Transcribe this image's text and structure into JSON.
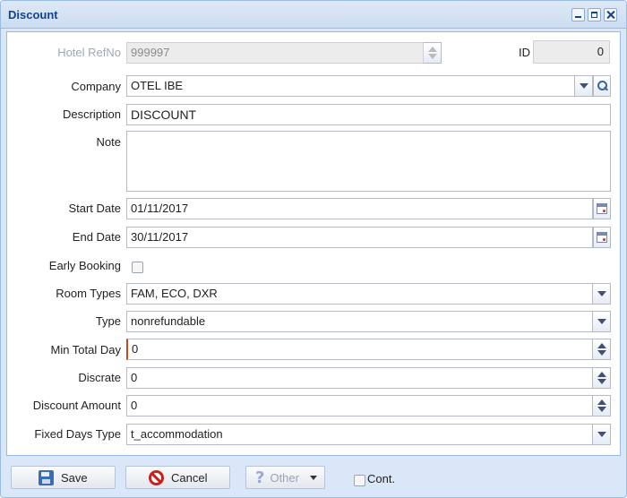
{
  "window": {
    "title": "Discount"
  },
  "form": {
    "hotel_refno": {
      "label": "Hotel RefNo",
      "value": "999997"
    },
    "id": {
      "label": "ID",
      "value": "0"
    },
    "company": {
      "label": "Company",
      "value": "OTEL IBE"
    },
    "description": {
      "label": "Description",
      "value": "DISCOUNT"
    },
    "note": {
      "label": "Note",
      "value": ""
    },
    "start_date": {
      "label": "Start Date",
      "value": "01/11/2017"
    },
    "end_date": {
      "label": "End Date",
      "value": "30/11/2017"
    },
    "early_booking": {
      "label": "Early Booking",
      "checked": false
    },
    "room_types": {
      "label": "Room Types",
      "value": "FAM, ECO, DXR"
    },
    "type": {
      "label": "Type",
      "value": "nonrefundable"
    },
    "min_total_day": {
      "label": "Min Total Day",
      "value": "0"
    },
    "discrate": {
      "label": "Discrate",
      "value": "0"
    },
    "discount_amount": {
      "label": "Discount Amount",
      "value": "0"
    },
    "fixed_days_type": {
      "label": "Fixed Days Type",
      "value": "t_accommodation"
    }
  },
  "footer": {
    "save_label": "Save",
    "cancel_label": "Cancel",
    "other_label": "Other",
    "cont_label": "Cont.",
    "cont_checked": false
  },
  "icons": {
    "save": "save-icon",
    "cancel": "cancel-icon",
    "other": "question-icon",
    "search": "search-icon",
    "calendar": "calendar-icon"
  }
}
